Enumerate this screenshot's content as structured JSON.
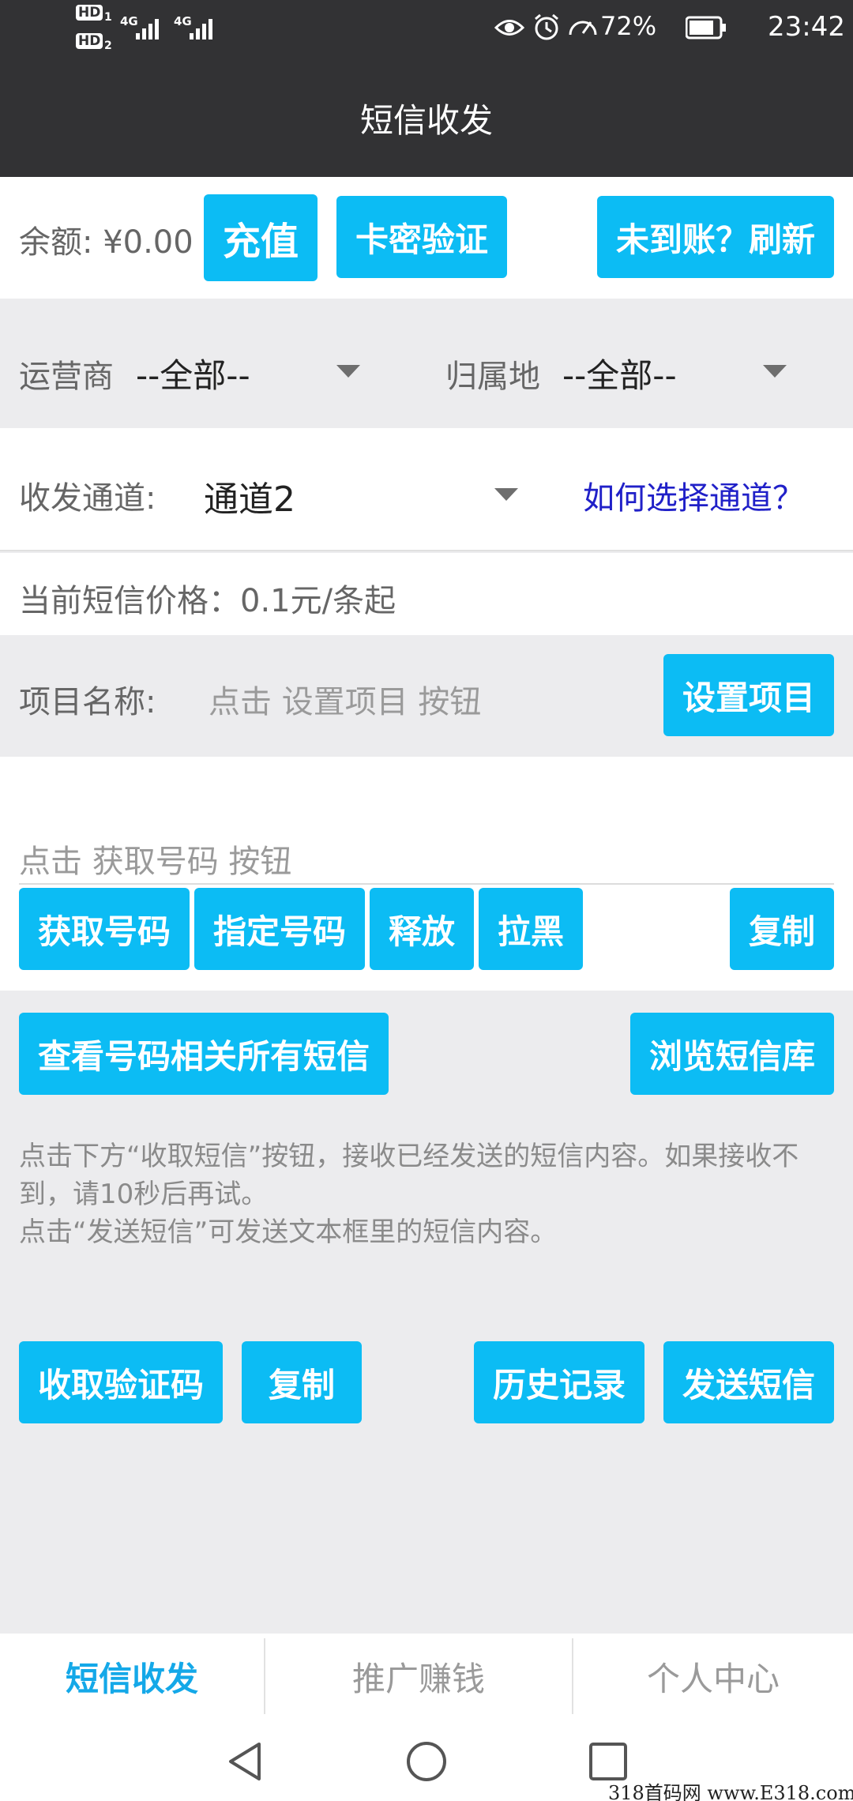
{
  "status": {
    "hd1": "HD",
    "hd1_sub": "1",
    "hd2": "HD",
    "hd2_sub": "2",
    "net1": "4G",
    "net2": "4G",
    "battery": "72%",
    "time": "23:42"
  },
  "title": "短信收发",
  "balance": {
    "label": "余额: ¥0.00",
    "recharge": "充值",
    "card_verify": "卡密验证",
    "refresh": "未到账？刷新"
  },
  "filters": {
    "carrier_label": "运营商",
    "carrier_value": "--全部--",
    "region_label": "归属地",
    "region_value": "--全部--"
  },
  "channel": {
    "label": "收发通道:",
    "value": "通道2",
    "help_link": "如何选择通道？"
  },
  "price": {
    "text": "当前短信价格：0.1元/条起"
  },
  "project": {
    "label": "项目名称:",
    "placeholder": "点击 设置项目 按钮",
    "set_button": "设置项目"
  },
  "phone": {
    "placeholder": "点击 获取号码 按钮",
    "get_number": "获取号码",
    "specify_number": "指定号码",
    "release": "释放",
    "blacklist": "拉黑",
    "copy": "复制"
  },
  "sms": {
    "view_all": "查看号码相关所有短信",
    "browse_library": "浏览短信库",
    "instructions_1": "点击下方“收取短信”按钮，接收已经发送的短信内容。如果接收不到，请10秒后再试。",
    "instructions_2": "点击“发送短信”可发送文本框里的短信内容。",
    "receive_code": "收取验证码",
    "copy": "复制",
    "history": "历史记录",
    "send": "发送短信"
  },
  "tabs": [
    {
      "label": "短信收发",
      "active": true
    },
    {
      "label": "推广赚钱",
      "active": false
    },
    {
      "label": "个人中心",
      "active": false
    }
  ],
  "watermark": "318首码网  www.E318.com",
  "colors": {
    "accent": "#0cbcf4",
    "dark_header": "#323234",
    "link": "#2020c8",
    "background": "#ececee"
  }
}
